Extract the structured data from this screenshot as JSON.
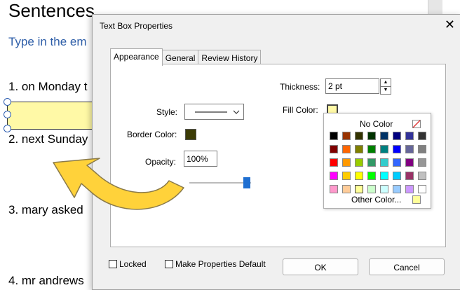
{
  "document": {
    "title": "Sentences",
    "subtitle": "Type in the em",
    "lines": [
      "1. on Monday t",
      "2. next Sunday",
      "3. mary asked",
      "4. mr andrews"
    ]
  },
  "dialog": {
    "title": "Text Box Properties",
    "close_glyph": "✕",
    "tabs": [
      {
        "label": "Appearance",
        "active": true
      },
      {
        "label": "General",
        "active": false
      },
      {
        "label": "Review History",
        "active": false
      }
    ],
    "style_label": "Style:",
    "border_color_label": "Border Color:",
    "border_color": "#3b3b05",
    "opacity_label": "Opacity:",
    "opacity_value": "100%",
    "opacity_fraction": 1.0,
    "thickness_label": "Thickness:",
    "thickness_value": "2 pt",
    "fill_color_label": "Fill Color:",
    "fill_color": "#fff9a6",
    "palette": {
      "no_color_label": "No Color",
      "other_color_label": "Other Color...",
      "colors": [
        [
          "#000000",
          "#993300",
          "#333300",
          "#003300",
          "#003366",
          "#000080",
          "#333399",
          "#333333"
        ],
        [
          "#800000",
          "#ff6600",
          "#808000",
          "#008000",
          "#008080",
          "#0000ff",
          "#666699",
          "#808080"
        ],
        [
          "#ff0000",
          "#ff9900",
          "#99cc00",
          "#339966",
          "#33cccc",
          "#3366ff",
          "#800080",
          "#969696"
        ],
        [
          "#ff00ff",
          "#ffcc00",
          "#ffff00",
          "#00ff00",
          "#00ffff",
          "#00ccff",
          "#993366",
          "#c0c0c0"
        ],
        [
          "#ff99cc",
          "#ffcc99",
          "#ffff99",
          "#ccffcc",
          "#ccffff",
          "#99ccff",
          "#cc99ff",
          "#ffffff"
        ]
      ]
    },
    "locked_label": "Locked",
    "default_label": "Make Properties Default",
    "ok_label": "OK",
    "cancel_label": "Cancel"
  },
  "colors": {
    "arrow": "#ffd23a",
    "arrow_outline": "#8a7a4a"
  }
}
